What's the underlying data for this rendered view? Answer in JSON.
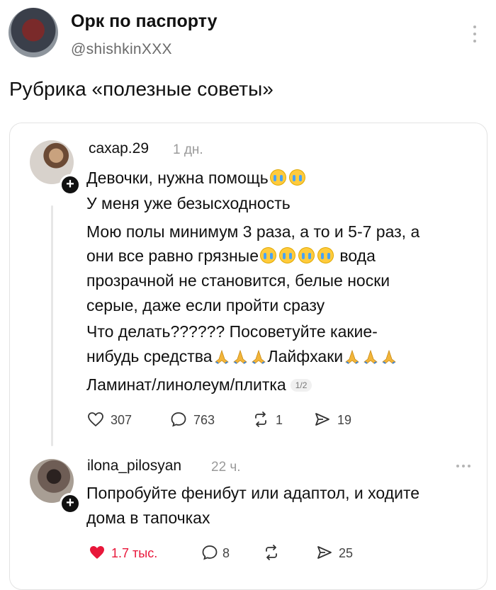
{
  "author": {
    "name": "Орк по паспорту",
    "handle": "@shishkinXXX"
  },
  "post": {
    "text": "Рубрика «полезные советы»"
  },
  "quote": {
    "username": "сахар.29",
    "time": "1 дн.",
    "lines": {
      "l1": "Девочки, нужна помощь",
      "l2": "У меня уже безысходность",
      "l3": "Мою полы минимум 3 раза, а то и 5-7 раз, а",
      "l4a": "они все равно грязные",
      "l4b": " вода",
      "l5": "прозрачной не становится, белые носки",
      "l6": "серые, даже если пройти сразу",
      "l7": "Что делать?????? Посоветуйте какие-",
      "l8a": "нибудь средства",
      "l8b": "Лайфхаки",
      "l9": "Ламинат/линолеум/плитка"
    },
    "page_badge": "1/2",
    "stats": {
      "likes": "307",
      "comments": "763",
      "reposts": "1",
      "shares": "19"
    }
  },
  "reply": {
    "username": "ilona_pilosyan",
    "time": "22 ч.",
    "line1": "Попробуйте фенибут или адаптол, и ходите",
    "line2": "дома в тапочках",
    "stats": {
      "likes": "1.7 тыс.",
      "comments": "8",
      "shares": "25"
    },
    "like_color": "#e8173a"
  }
}
